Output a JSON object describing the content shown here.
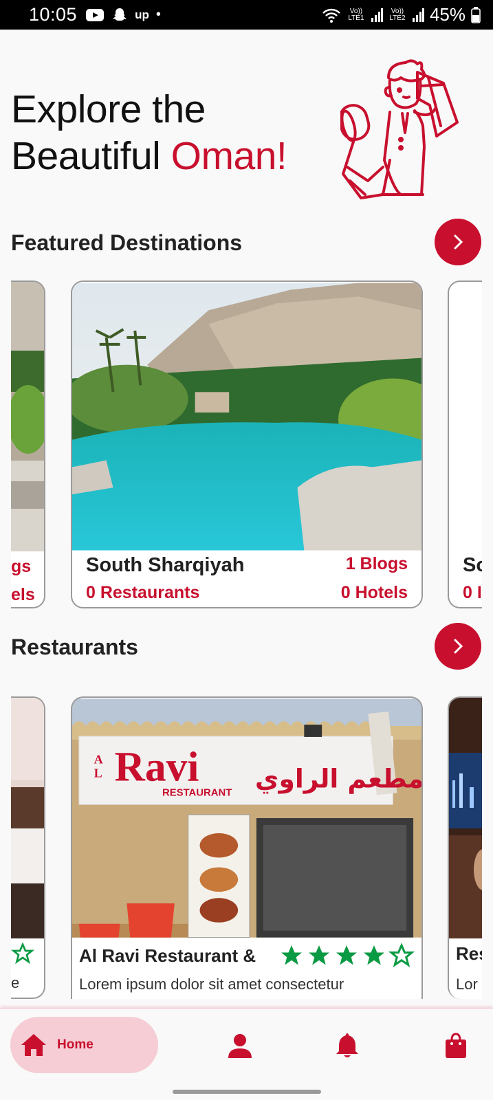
{
  "status_bar": {
    "time": "10:05",
    "battery": "45%",
    "carrier1": "Vo)) LTE1",
    "carrier2": "Vo)) LTE2"
  },
  "hero": {
    "line1": "Explore the",
    "line2_prefix": "Beautiful ",
    "line2_accent": "Oman!"
  },
  "featured": {
    "title": "Featured Destinations",
    "left_peek": {
      "blogs": "gs",
      "hotels": "els"
    },
    "right_peek": {
      "name": "So",
      "restaurants": "0 I"
    },
    "card": {
      "name": "South Sharqiyah",
      "blogs": "1 Blogs",
      "restaurants": "0 Restaurants",
      "hotels": "0 Hotels"
    }
  },
  "restaurants": {
    "title": "Restaurants",
    "left_peek_desc": "e",
    "right_peek": {
      "name": "Res",
      "desc": "Lor"
    },
    "card": {
      "name": "Al Ravi Restaurant &",
      "description": "Lorem ipsum dolor sit amet consectetur",
      "rating": 4,
      "max_rating": 5,
      "sign_latin_small": "AL",
      "sign_latin": "Ravi",
      "sign_sub": "RESTAURANT",
      "sign_arabic": "مطعم الراوي"
    }
  },
  "nav": {
    "home_label": "Home"
  },
  "colors": {
    "accent": "#c8102e",
    "star": "#0a9a43"
  }
}
